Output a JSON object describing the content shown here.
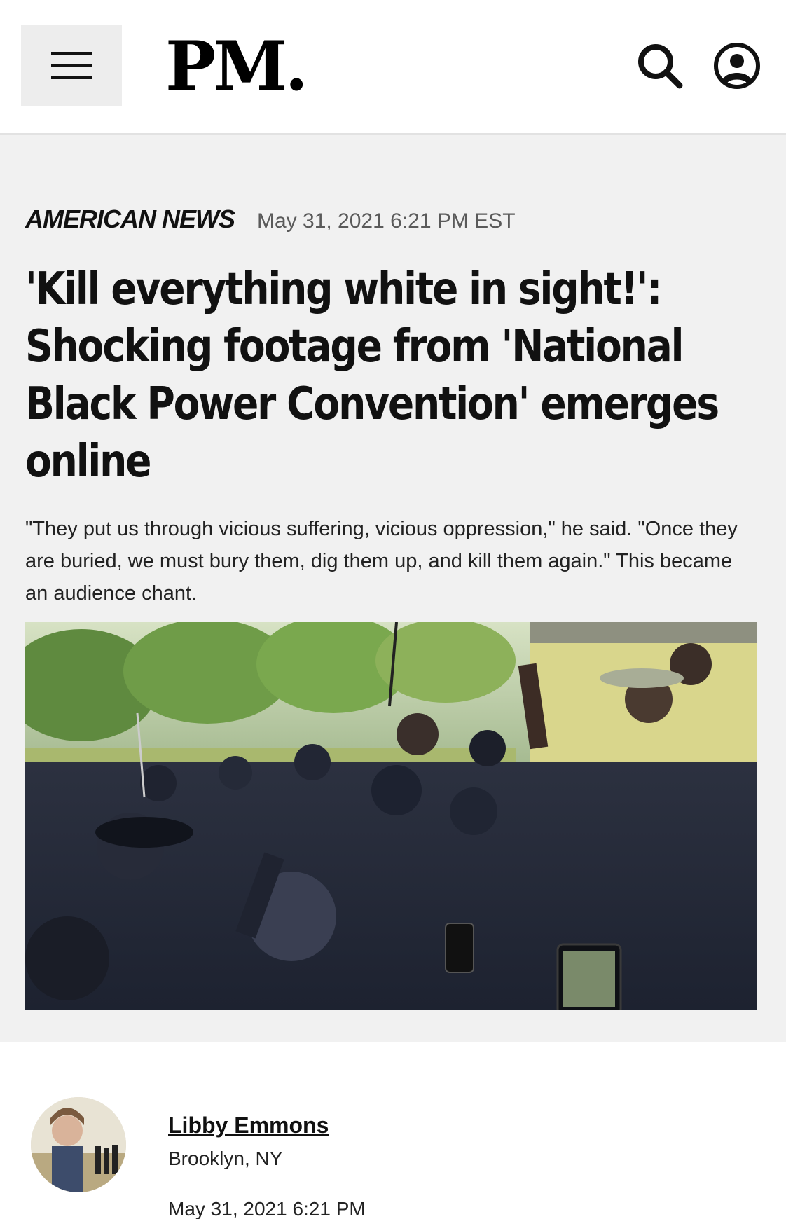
{
  "header": {
    "logo": "PM.",
    "menu_icon": "hamburger-menu-icon",
    "search_icon": "search-icon",
    "account_icon": "user-account-icon"
  },
  "article": {
    "category": "AMERICAN NEWS",
    "published": "May 31, 2021 6:21 PM EST",
    "headline": "'Kill everything white in sight!': Shocking footage from 'National Black Power Convention' emerges online",
    "dek": "\"They put us through vicious suffering, vicious oppression,\" he said. \"Once they are buried, we must bury them, dig them up, and kill them again.\" This became an audience chant."
  },
  "author": {
    "name": "Libby Emmons",
    "location": "Brooklyn, NY",
    "date": "May 31, 2021 6:21 PM"
  },
  "colors": {
    "header_bg": "#ffffff",
    "article_bg": "#f1f1f1",
    "menu_button_bg": "#ededed",
    "text": "#111111",
    "meta_text": "#5a5a5a"
  }
}
